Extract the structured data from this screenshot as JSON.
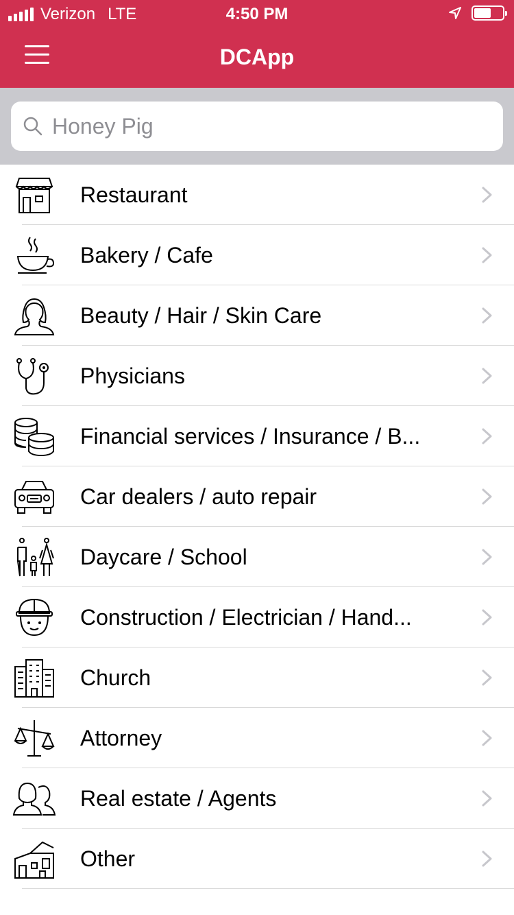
{
  "status_bar": {
    "carrier": "Verizon",
    "network": "LTE",
    "time": "4:50 PM",
    "battery_level": 0.6
  },
  "nav": {
    "title": "DCApp",
    "menu_icon": "hamburger-menu-icon"
  },
  "search": {
    "value": "",
    "placeholder": "Honey Pig"
  },
  "categories": [
    {
      "label": "Restaurant",
      "icon": "storefront-icon"
    },
    {
      "label": "Bakery / Cafe",
      "icon": "coffee-cup-icon"
    },
    {
      "label": "Beauty / Hair / Skin Care",
      "icon": "woman-silhouette-icon"
    },
    {
      "label": "Physicians",
      "icon": "stethoscope-icon"
    },
    {
      "label": "Financial services / Insurance / B...",
      "icon": "coin-stack-icon"
    },
    {
      "label": "Car dealers / auto repair",
      "icon": "car-icon"
    },
    {
      "label": "Daycare / School",
      "icon": "family-icon"
    },
    {
      "label": "Construction / Electrician / Hand...",
      "icon": "construction-worker-icon"
    },
    {
      "label": "Church",
      "icon": "buildings-icon"
    },
    {
      "label": "Attorney",
      "icon": "scales-icon"
    },
    {
      "label": "Real estate / Agents",
      "icon": "agents-icon"
    },
    {
      "label": "Other",
      "icon": "house-icon"
    }
  ],
  "colors": {
    "header": "#d03050",
    "search_bar_bg": "#c9c9ce",
    "chevron": "#c7c7cc"
  }
}
